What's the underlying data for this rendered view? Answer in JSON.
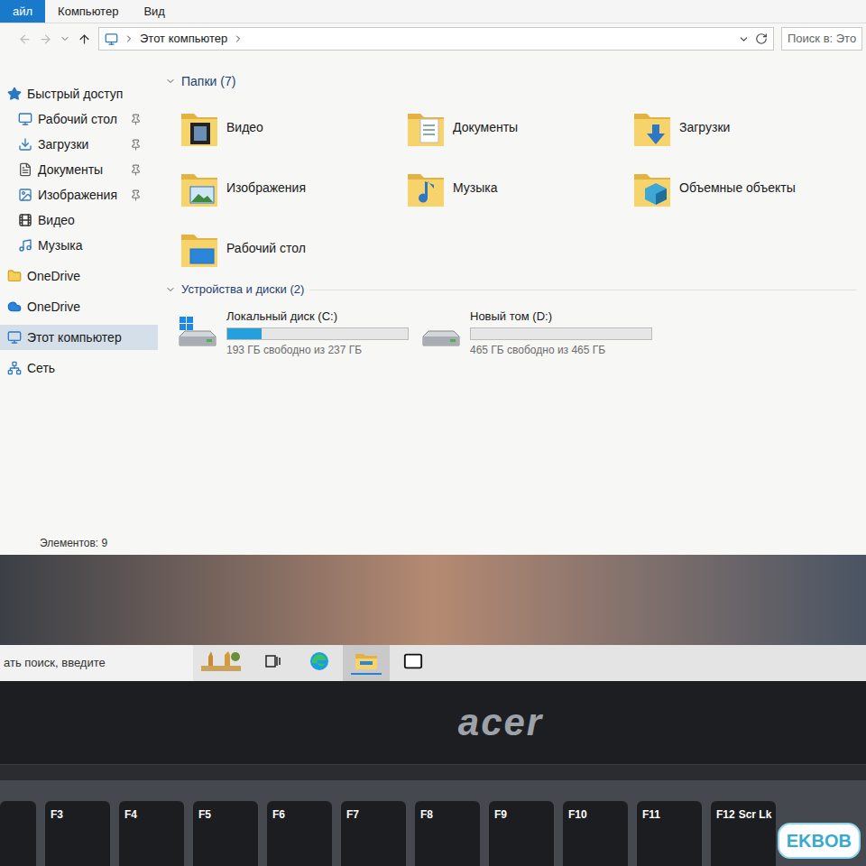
{
  "ribbon": {
    "tabs": [
      {
        "label": "айл",
        "selected": true
      },
      {
        "label": "Компьютер",
        "selected": false
      },
      {
        "label": "Вид",
        "selected": false
      }
    ]
  },
  "address": {
    "path": "Этот компьютер"
  },
  "search": {
    "placeholder": "Поиск в: Это"
  },
  "sidebar": {
    "groups": [
      {
        "label": "Быстрый доступ",
        "kind": "star",
        "selected": false,
        "children": [
          {
            "label": "Рабочий стол",
            "kind": "desktop",
            "pinned": true,
            "selected": false
          },
          {
            "label": "Загрузки",
            "kind": "downloads",
            "pinned": true,
            "selected": false
          },
          {
            "label": "Документы",
            "kind": "documents",
            "pinned": true,
            "selected": false
          },
          {
            "label": "Изображения",
            "kind": "pictures",
            "pinned": true,
            "selected": false
          },
          {
            "label": "Видео",
            "kind": "video",
            "pinned": false,
            "selected": false
          },
          {
            "label": "Музыка",
            "kind": "music",
            "pinned": false,
            "selected": false
          }
        ]
      },
      {
        "label": "OneDrive",
        "kind": "onedrive-folder",
        "selected": false,
        "children": []
      },
      {
        "label": "OneDrive",
        "kind": "onedrive-cloud",
        "selected": false,
        "children": []
      },
      {
        "label": "Этот компьютер",
        "kind": "pc",
        "selected": true,
        "children": []
      },
      {
        "label": "Сеть",
        "kind": "network",
        "selected": false,
        "children": []
      }
    ]
  },
  "folders": {
    "title": "Папки (7)",
    "expanded": true,
    "items": [
      {
        "label": "Видео",
        "kind": "video"
      },
      {
        "label": "Документы",
        "kind": "documents"
      },
      {
        "label": "Загрузки",
        "kind": "downloads"
      },
      {
        "label": "Изображения",
        "kind": "pictures"
      },
      {
        "label": "Музыка",
        "kind": "music"
      },
      {
        "label": "Объемные объекты",
        "kind": "objects3d"
      },
      {
        "label": "Рабочий стол",
        "kind": "desktop"
      }
    ]
  },
  "drives": {
    "title": "Устройства и диски (2)",
    "expanded": true,
    "items": [
      {
        "label": "Локальный диск (C:)",
        "free": "193 ГБ свободно из 237 ГБ",
        "level": 0.19,
        "kind": "system"
      },
      {
        "label": "Новый том (D:)",
        "free": "465 ГБ свободно из 465 ГБ",
        "level": 0,
        "kind": "data"
      }
    ]
  },
  "status_bar": {
    "count": "Элементов: 9"
  },
  "taskbar": {
    "search_placeholder": "ать поиск, введите",
    "apps": [
      {
        "kind": "search-highlight",
        "active": false
      },
      {
        "kind": "task-view",
        "active": false
      },
      {
        "kind": "edge",
        "active": false
      },
      {
        "kind": "explorer",
        "active": true
      },
      {
        "kind": "mail",
        "active": false
      }
    ]
  },
  "laptop": {
    "logo": "acer"
  },
  "keys": [
    {
      "label": "F3",
      "sub": ""
    },
    {
      "label": "F4",
      "sub": ""
    },
    {
      "label": "F5",
      "sub": ""
    },
    {
      "label": "F6",
      "sub": ""
    },
    {
      "label": "F7",
      "sub": ""
    },
    {
      "label": "F8",
      "sub": ""
    },
    {
      "label": "F9",
      "sub": ""
    },
    {
      "label": "F10",
      "sub": ""
    },
    {
      "label": "F11",
      "sub": ""
    },
    {
      "label": "F12",
      "sub": "Scr Lk"
    }
  ],
  "watermark": "EKBOB"
}
